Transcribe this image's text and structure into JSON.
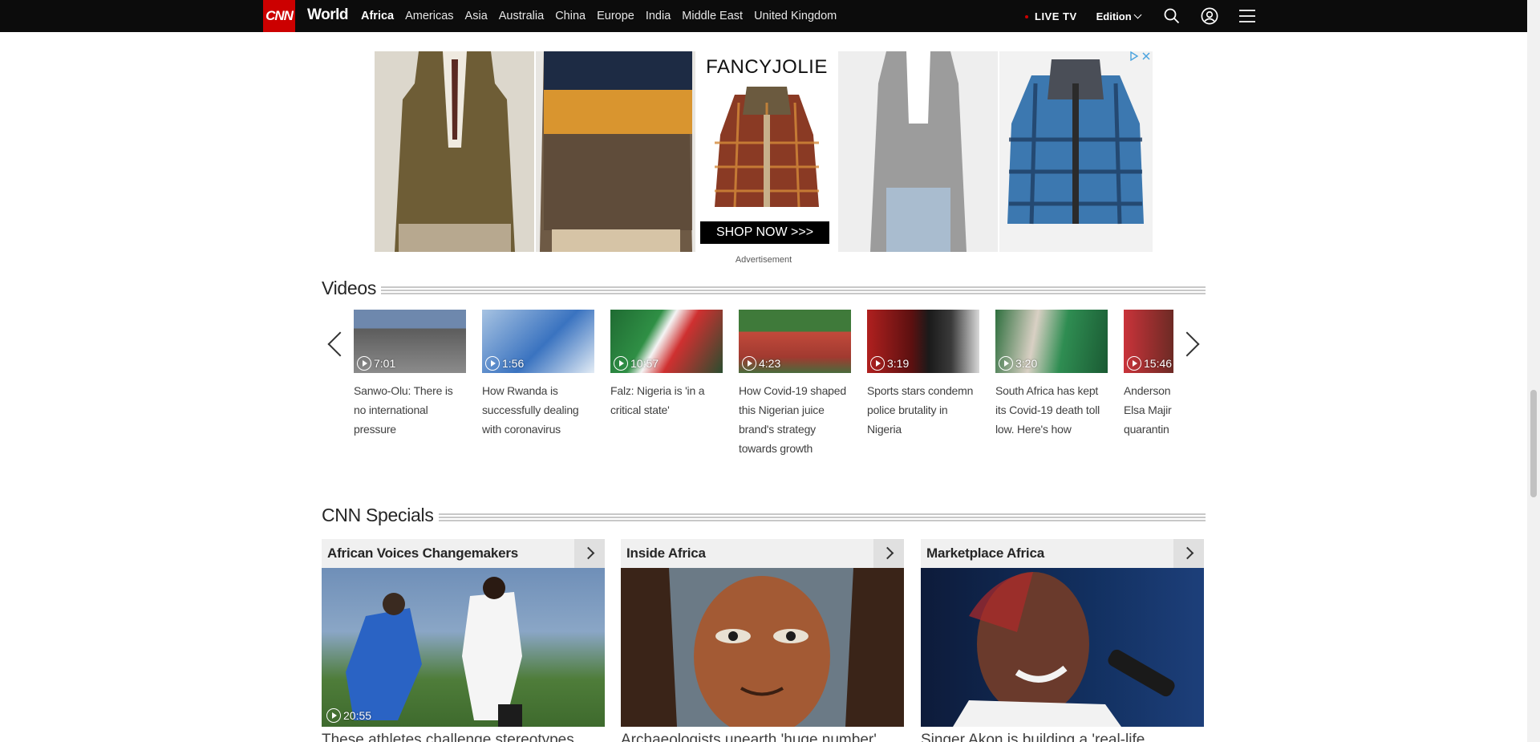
{
  "nav": {
    "logo": "CNN",
    "section": "World",
    "links": [
      "Africa",
      "Americas",
      "Asia",
      "Australia",
      "China",
      "Europe",
      "India",
      "Middle East",
      "United Kingdom"
    ],
    "active_link": "Africa",
    "live_tv": "LIVE TV",
    "edition": "Edition",
    "icons": [
      "search-icon",
      "account-icon",
      "menu-icon"
    ]
  },
  "ad": {
    "brand": "FANCYJOLIE",
    "cta": "SHOP NOW >>>",
    "label": "Advertisement"
  },
  "videos": {
    "title": "Videos",
    "items": [
      {
        "duration": "7:01",
        "title": "Sanwo-Olu: There is no international pressure"
      },
      {
        "duration": "1:56",
        "title": "How Rwanda is successfully dealing with coronavirus"
      },
      {
        "duration": "10:57",
        "title": "Falz: Nigeria is 'in a critical state'"
      },
      {
        "duration": "4:23",
        "title": "How Covid-19 shaped this Nigerian juice brand's strategy towards growth"
      },
      {
        "duration": "3:19",
        "title": "Sports stars condemn police brutality in Nigeria"
      },
      {
        "duration": "3:20",
        "title": "South Africa has kept its Covid-19 death toll low. Here's how"
      },
      {
        "duration": "15:46",
        "title": "Anderson talks with Elsa Majir life during quarantin"
      }
    ]
  },
  "specials": {
    "title": "CNN Specials",
    "items": [
      {
        "title": "African Voices Changemakers",
        "duration": "20:55",
        "caption": "These athletes challenge stereotypes"
      },
      {
        "title": "Inside Africa",
        "duration": "",
        "caption": "Archaeologists unearth 'huge number'"
      },
      {
        "title": "Marketplace Africa",
        "duration": "",
        "caption": "Singer Akon is building a 'real-life"
      }
    ]
  },
  "colors": {
    "nav_bg": "#0c0c0c",
    "brand_red": "#cc0000",
    "text": "#262626"
  }
}
